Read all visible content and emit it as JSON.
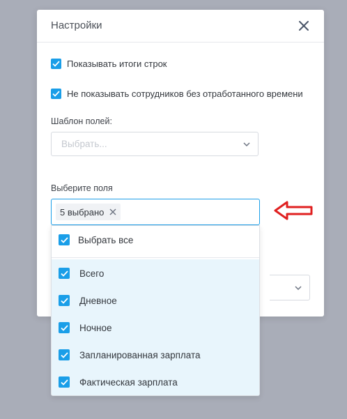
{
  "modal": {
    "title": "Настройки",
    "options": [
      {
        "label": "Показывать итоги строк",
        "checked": true
      },
      {
        "label": "Не показывать сотрудников без отработанного времени",
        "checked": true
      }
    ],
    "template": {
      "label": "Шаблон полей:",
      "placeholder": "Выбрать..."
    },
    "fields": {
      "label": "Выберите поля",
      "chip": "5 выбрано",
      "select_all": "Выбрать все",
      "items": [
        {
          "label": "Всего",
          "checked": true
        },
        {
          "label": "Дневное",
          "checked": true
        },
        {
          "label": "Ночное",
          "checked": true
        },
        {
          "label": "Запланированная зарплата",
          "checked": true
        },
        {
          "label": "Фактическая зарплата",
          "checked": true
        }
      ]
    }
  },
  "colors": {
    "accent": "#1a9ee8",
    "annotation_arrow": "#e02020",
    "dropdown_highlight": "#e8f5fc"
  },
  "icons": [
    "close-icon",
    "chevron-down-icon",
    "checkbox-checked-icon",
    "chip-remove-icon",
    "annotation-arrow-icon"
  ]
}
